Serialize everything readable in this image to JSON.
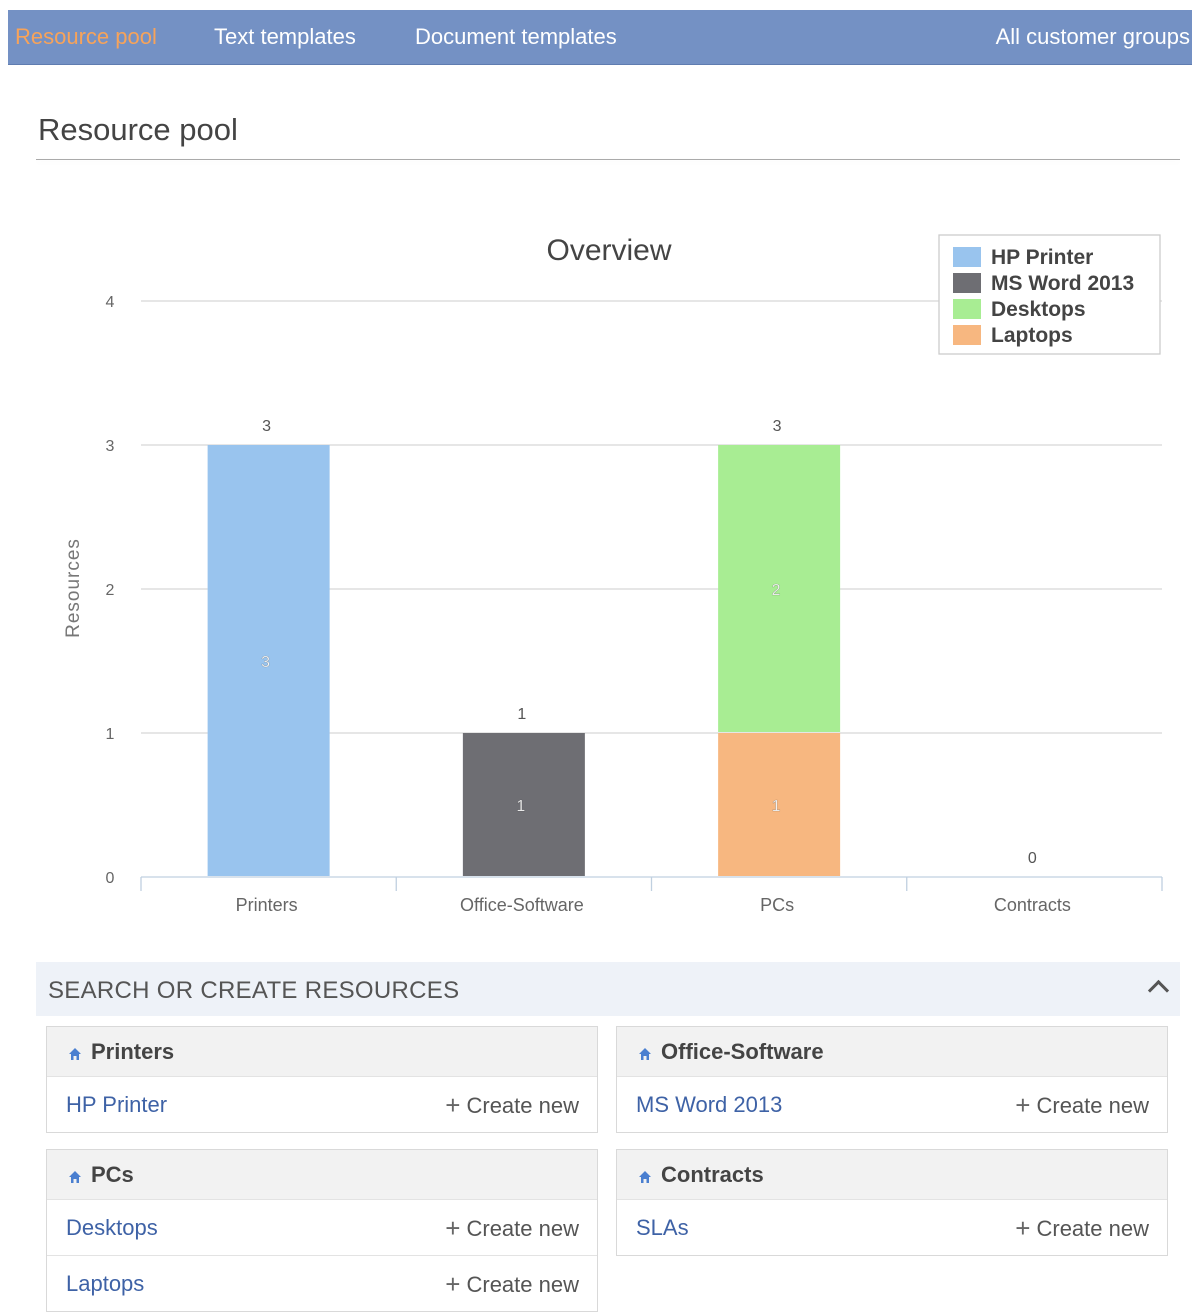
{
  "nav": {
    "items": [
      {
        "label": "Resource pool",
        "active": true
      },
      {
        "label": "Text templates",
        "active": false
      },
      {
        "label": "Document templates",
        "active": false
      }
    ],
    "right_label": "All customer groups"
  },
  "page": {
    "title": "Resource pool"
  },
  "chart_data": {
    "type": "bar",
    "stacked": true,
    "title": "Overview",
    "xlabel": "",
    "ylabel": "Resources",
    "ylim": [
      0,
      4
    ],
    "yticks": [
      0,
      1,
      2,
      3,
      4
    ],
    "categories": [
      "Printers",
      "Office-Software",
      "PCs",
      "Contracts"
    ],
    "totals": [
      3,
      1,
      3,
      0
    ],
    "series": [
      {
        "name": "HP Printer",
        "color": "#99c4ee",
        "values": [
          3,
          0,
          0,
          0
        ]
      },
      {
        "name": "MS Word 2013",
        "color": "#6e6e73",
        "values": [
          0,
          1,
          0,
          0
        ]
      },
      {
        "name": "Desktops",
        "color": "#a8ed93",
        "values": [
          0,
          0,
          2,
          0
        ]
      },
      {
        "name": "Laptops",
        "color": "#f7b780",
        "values": [
          0,
          0,
          1,
          0
        ]
      }
    ],
    "legend": "top-right",
    "grid": true
  },
  "panel": {
    "title": "SEARCH OR CREATE RESOURCES",
    "create_label": "Create new",
    "groups": [
      {
        "name": "Printers",
        "items": [
          "HP Printer"
        ]
      },
      {
        "name": "Office-Software",
        "items": [
          "MS Word 2013"
        ]
      },
      {
        "name": "PCs",
        "items": [
          "Desktops",
          "Laptops"
        ]
      },
      {
        "name": "Contracts",
        "items": [
          "SLAs"
        ]
      }
    ]
  }
}
